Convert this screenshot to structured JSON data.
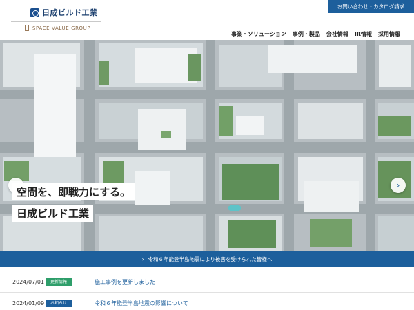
{
  "header": {
    "logo_text": "日成ビルド工業",
    "group_text": "SPACE VALUE GROUP",
    "contact_label": "お問い合わせ・カタログ請求",
    "nav": [
      "事業・ソリューション",
      "事例・製品",
      "会社情報",
      "IR情報",
      "採用情報"
    ]
  },
  "hero": {
    "catch_line1": "空間を、即戦力にする。",
    "catch_line2": "日成ビルド工業",
    "prev_label": "‹",
    "next_label": "›"
  },
  "notice": {
    "text": "令和６年能登半島地震により被害を受けられた皆様へ"
  },
  "news": [
    {
      "date": "2024/07/01",
      "category": "更新情報",
      "category_color": "#2e9e6a",
      "title": "施工事例を更新しました"
    },
    {
      "date": "2024/01/09",
      "category": "お知らせ",
      "category_color": "#1d5f9c",
      "title": "令和６年能登半島地震の影響について"
    }
  ],
  "colors": {
    "brand_blue": "#1d5f9c",
    "update_green": "#2e9e6a"
  }
}
